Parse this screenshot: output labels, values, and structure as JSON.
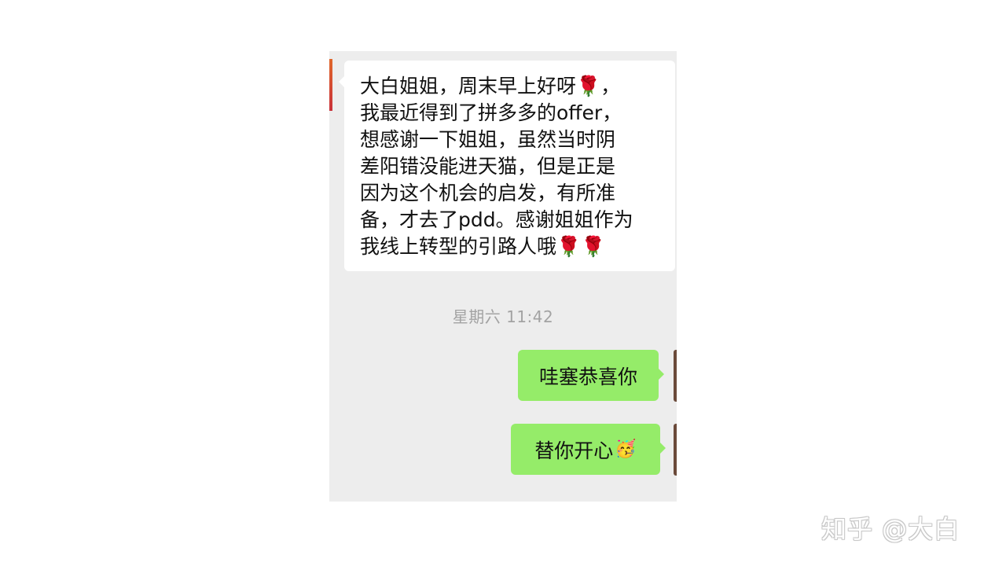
{
  "chat": {
    "incoming": {
      "lines": [
        "大白姐姐，周末早上好呀🌹，",
        "我最近得到了拼多多的offer，",
        "想感谢一下姐姐，虽然当时阴",
        "差阳错没能进天猫，但是正是",
        "因为这个机会的启发，有所准",
        "备，才去了pdd。感谢姐姐作为",
        "我线上转型的引路人哦🌹🌹"
      ]
    },
    "timestamp": "星期六 11:42",
    "outgoing": [
      {
        "text": "哇塞恭喜你",
        "emoji": ""
      },
      {
        "text": "替你开心",
        "emoji": "🥳"
      }
    ]
  },
  "watermark": "知乎 @大白",
  "colors": {
    "chat_background": "#ededed",
    "incoming_bubble": "#ffffff",
    "outgoing_bubble": "#95ec69",
    "timestamp_text": "#a3a3a3"
  }
}
